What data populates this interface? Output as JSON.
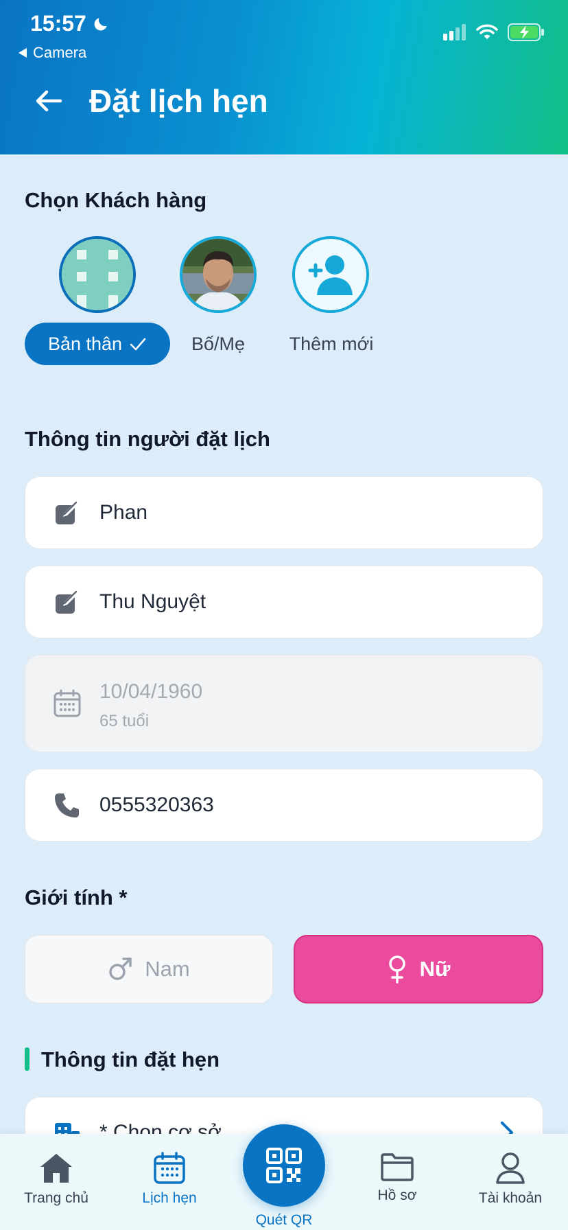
{
  "status_bar": {
    "time": "15:57",
    "back_app": "Camera"
  },
  "header": {
    "title": "Đặt lịch hẹn"
  },
  "customer_section": {
    "title": "Chọn Khách hàng",
    "options": [
      {
        "label": "Bản thân"
      },
      {
        "label": "Bố/Mẹ"
      },
      {
        "label": "Thêm mới"
      }
    ]
  },
  "booker_section": {
    "title": "Thông tin người đặt lịch",
    "last_name": "Phan",
    "first_name": "Thu Nguyệt",
    "birth_date": "10/04/1960",
    "age": "65 tuổi",
    "phone": "0555320363"
  },
  "gender_section": {
    "title": "Giới tính *",
    "male": "Nam",
    "female": "Nữ",
    "selected": "female"
  },
  "appointment_section": {
    "title": "Thông tin đặt hẹn",
    "facility_placeholder": "* Chọn cơ sở"
  },
  "bottom_nav": {
    "home": "Trang chủ",
    "appointments": "Lịch hẹn",
    "scan_qr": "Quét QR",
    "records": "Hồ sơ",
    "account": "Tài khoản"
  },
  "colors": {
    "primary": "#0a74c4",
    "accent_green": "#12bf86",
    "female_pink": "#ea4b9c"
  }
}
